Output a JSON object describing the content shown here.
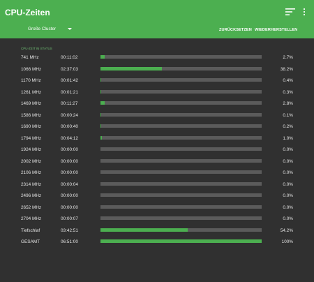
{
  "appbar": {
    "title": "CPU-Zeiten",
    "sort_icon": "sort-icon",
    "menu_icon": "more-vert-icon"
  },
  "toolbar": {
    "cluster_label": "Große Cluster",
    "reset_label": "ZURÜCKSETZEN",
    "restore_label": "WIEDERHERSTELLEN"
  },
  "section_title": "CPU-ZEIT IN STATUS",
  "rows": [
    {
      "freq": "741 MHz",
      "time": "00:11:02",
      "percent": "2.7%",
      "fraction": 0.027
    },
    {
      "freq": "1066 MHz",
      "time": "02:37:03",
      "percent": "38.2%",
      "fraction": 0.382
    },
    {
      "freq": "1170 MHz",
      "time": "00:01:42",
      "percent": "0.4%",
      "fraction": 0.004
    },
    {
      "freq": "1261 MHz",
      "time": "00:01:21",
      "percent": "0.3%",
      "fraction": 0.003
    },
    {
      "freq": "1469 MHz",
      "time": "00:11:27",
      "percent": "2.8%",
      "fraction": 0.028
    },
    {
      "freq": "1586 MHz",
      "time": "00:00:24",
      "percent": "0.1%",
      "fraction": 0.001
    },
    {
      "freq": "1690 MHz",
      "time": "00:00:40",
      "percent": "0.2%",
      "fraction": 0.002
    },
    {
      "freq": "1794 MHz",
      "time": "00:04:12",
      "percent": "1.0%",
      "fraction": 0.01
    },
    {
      "freq": "1924 MHz",
      "time": "00:00:00",
      "percent": "0.0%",
      "fraction": 0.0
    },
    {
      "freq": "2002 MHz",
      "time": "00:00:00",
      "percent": "0.0%",
      "fraction": 0.0
    },
    {
      "freq": "2106 MHz",
      "time": "00:00:00",
      "percent": "0.0%",
      "fraction": 0.0
    },
    {
      "freq": "2314 MHz",
      "time": "00:00:04",
      "percent": "0.0%",
      "fraction": 0.0
    },
    {
      "freq": "2496 MHz",
      "time": "00:00:00",
      "percent": "0.0%",
      "fraction": 0.0
    },
    {
      "freq": "2652 MHz",
      "time": "00:00:00",
      "percent": "0.0%",
      "fraction": 0.0
    },
    {
      "freq": "2704 MHz",
      "time": "00:00:07",
      "percent": "0.0%",
      "fraction": 0.0
    },
    {
      "freq": "Tiefschlaf",
      "time": "03:42:51",
      "percent": "54.2%",
      "fraction": 0.542
    },
    {
      "freq": "GESAMT",
      "time": "06:51:00",
      "percent": "100%",
      "fraction": 1.0
    }
  ],
  "colors": {
    "accent": "#4caf50",
    "background": "#303030",
    "track": "#5b5b5b"
  }
}
